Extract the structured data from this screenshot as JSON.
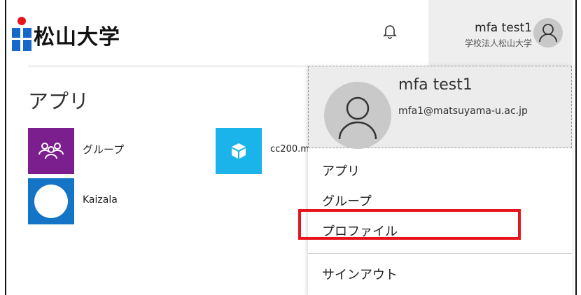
{
  "header": {
    "brand_text": "松山大学",
    "user_name": "mfa test1",
    "user_org": "学校法人松山大学"
  },
  "apps": {
    "title": "アプリ",
    "tiles": [
      {
        "label": "グループ",
        "color": "#7b1f8f",
        "icon": "people-icon"
      },
      {
        "label": "cc200.m",
        "color": "#1ab4ea",
        "icon": "cube-icon"
      },
      {
        "label": "Kaizala",
        "color": "#1475c7",
        "icon": "circle-icon"
      }
    ]
  },
  "dropdown": {
    "name": "mfa test1",
    "email": "mfa1@matsuyama-u.ac.jp",
    "items": [
      "アプリ",
      "グループ",
      "プロファイル",
      "サインアウト"
    ]
  },
  "highlight_color": "#e8141b"
}
